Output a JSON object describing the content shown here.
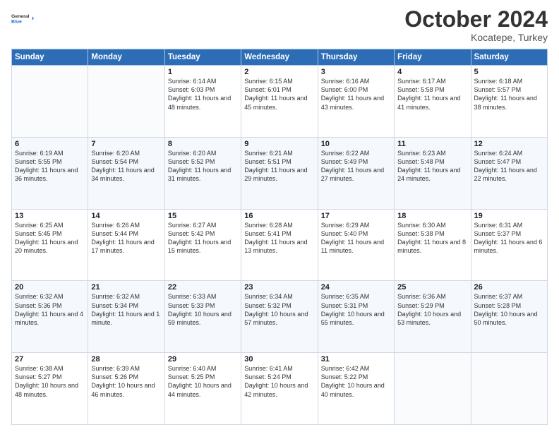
{
  "header": {
    "logo_line1": "General",
    "logo_line2": "Blue",
    "month": "October 2024",
    "location": "Kocatepe, Turkey"
  },
  "weekdays": [
    "Sunday",
    "Monday",
    "Tuesday",
    "Wednesday",
    "Thursday",
    "Friday",
    "Saturday"
  ],
  "weeks": [
    [
      {
        "day": "",
        "text": ""
      },
      {
        "day": "",
        "text": ""
      },
      {
        "day": "1",
        "text": "Sunrise: 6:14 AM\nSunset: 6:03 PM\nDaylight: 11 hours and 48 minutes."
      },
      {
        "day": "2",
        "text": "Sunrise: 6:15 AM\nSunset: 6:01 PM\nDaylight: 11 hours and 45 minutes."
      },
      {
        "day": "3",
        "text": "Sunrise: 6:16 AM\nSunset: 6:00 PM\nDaylight: 11 hours and 43 minutes."
      },
      {
        "day": "4",
        "text": "Sunrise: 6:17 AM\nSunset: 5:58 PM\nDaylight: 11 hours and 41 minutes."
      },
      {
        "day": "5",
        "text": "Sunrise: 6:18 AM\nSunset: 5:57 PM\nDaylight: 11 hours and 38 minutes."
      }
    ],
    [
      {
        "day": "6",
        "text": "Sunrise: 6:19 AM\nSunset: 5:55 PM\nDaylight: 11 hours and 36 minutes."
      },
      {
        "day": "7",
        "text": "Sunrise: 6:20 AM\nSunset: 5:54 PM\nDaylight: 11 hours and 34 minutes."
      },
      {
        "day": "8",
        "text": "Sunrise: 6:20 AM\nSunset: 5:52 PM\nDaylight: 11 hours and 31 minutes."
      },
      {
        "day": "9",
        "text": "Sunrise: 6:21 AM\nSunset: 5:51 PM\nDaylight: 11 hours and 29 minutes."
      },
      {
        "day": "10",
        "text": "Sunrise: 6:22 AM\nSunset: 5:49 PM\nDaylight: 11 hours and 27 minutes."
      },
      {
        "day": "11",
        "text": "Sunrise: 6:23 AM\nSunset: 5:48 PM\nDaylight: 11 hours and 24 minutes."
      },
      {
        "day": "12",
        "text": "Sunrise: 6:24 AM\nSunset: 5:47 PM\nDaylight: 11 hours and 22 minutes."
      }
    ],
    [
      {
        "day": "13",
        "text": "Sunrise: 6:25 AM\nSunset: 5:45 PM\nDaylight: 11 hours and 20 minutes."
      },
      {
        "day": "14",
        "text": "Sunrise: 6:26 AM\nSunset: 5:44 PM\nDaylight: 11 hours and 17 minutes."
      },
      {
        "day": "15",
        "text": "Sunrise: 6:27 AM\nSunset: 5:42 PM\nDaylight: 11 hours and 15 minutes."
      },
      {
        "day": "16",
        "text": "Sunrise: 6:28 AM\nSunset: 5:41 PM\nDaylight: 11 hours and 13 minutes."
      },
      {
        "day": "17",
        "text": "Sunrise: 6:29 AM\nSunset: 5:40 PM\nDaylight: 11 hours and 11 minutes."
      },
      {
        "day": "18",
        "text": "Sunrise: 6:30 AM\nSunset: 5:38 PM\nDaylight: 11 hours and 8 minutes."
      },
      {
        "day": "19",
        "text": "Sunrise: 6:31 AM\nSunset: 5:37 PM\nDaylight: 11 hours and 6 minutes."
      }
    ],
    [
      {
        "day": "20",
        "text": "Sunrise: 6:32 AM\nSunset: 5:36 PM\nDaylight: 11 hours and 4 minutes."
      },
      {
        "day": "21",
        "text": "Sunrise: 6:32 AM\nSunset: 5:34 PM\nDaylight: 11 hours and 1 minute."
      },
      {
        "day": "22",
        "text": "Sunrise: 6:33 AM\nSunset: 5:33 PM\nDaylight: 10 hours and 59 minutes."
      },
      {
        "day": "23",
        "text": "Sunrise: 6:34 AM\nSunset: 5:32 PM\nDaylight: 10 hours and 57 minutes."
      },
      {
        "day": "24",
        "text": "Sunrise: 6:35 AM\nSunset: 5:31 PM\nDaylight: 10 hours and 55 minutes."
      },
      {
        "day": "25",
        "text": "Sunrise: 6:36 AM\nSunset: 5:29 PM\nDaylight: 10 hours and 53 minutes."
      },
      {
        "day": "26",
        "text": "Sunrise: 6:37 AM\nSunset: 5:28 PM\nDaylight: 10 hours and 50 minutes."
      }
    ],
    [
      {
        "day": "27",
        "text": "Sunrise: 6:38 AM\nSunset: 5:27 PM\nDaylight: 10 hours and 48 minutes."
      },
      {
        "day": "28",
        "text": "Sunrise: 6:39 AM\nSunset: 5:26 PM\nDaylight: 10 hours and 46 minutes."
      },
      {
        "day": "29",
        "text": "Sunrise: 6:40 AM\nSunset: 5:25 PM\nDaylight: 10 hours and 44 minutes."
      },
      {
        "day": "30",
        "text": "Sunrise: 6:41 AM\nSunset: 5:24 PM\nDaylight: 10 hours and 42 minutes."
      },
      {
        "day": "31",
        "text": "Sunrise: 6:42 AM\nSunset: 5:22 PM\nDaylight: 10 hours and 40 minutes."
      },
      {
        "day": "",
        "text": ""
      },
      {
        "day": "",
        "text": ""
      }
    ]
  ]
}
